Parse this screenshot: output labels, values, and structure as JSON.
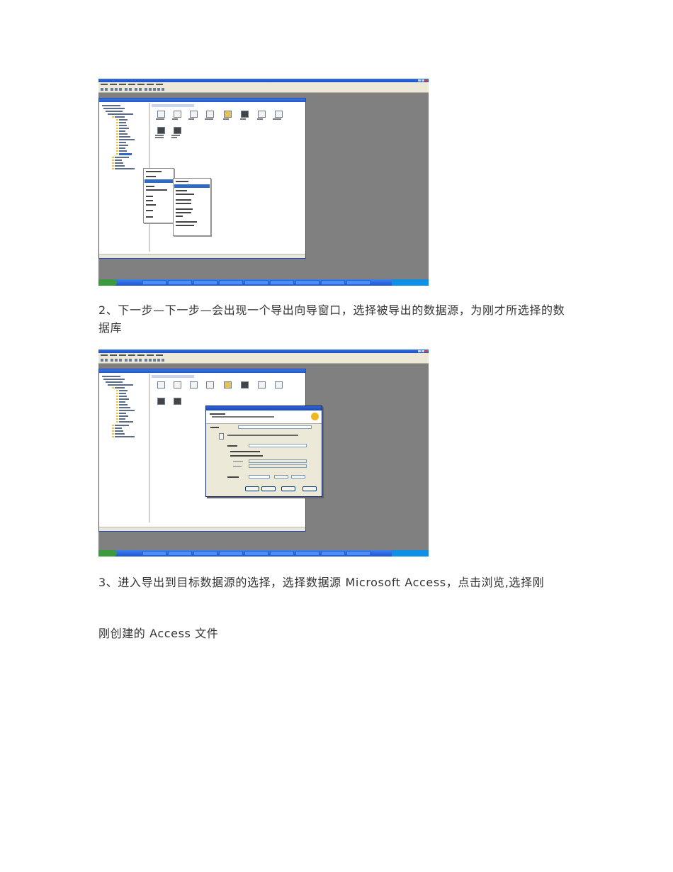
{
  "paragraphs": {
    "step2": "2、下一步—下一步—会出现一个导出向导窗口，选择被导出的数据源，为刚才所选择的数据库",
    "step3": "3、进入导出到目标数据源的选择，选择数据源 Microsoft Access，点击浏览,选择刚",
    "step3_cont": "刚创建的 Access 文件"
  },
  "screenshots": [
    {
      "description_id": "enterprise-manager-context-menu"
    },
    {
      "description_id": "export-wizard-choose-source"
    }
  ],
  "colors": {
    "xp_blue": "#2f6fe0",
    "window_gray": "#808080",
    "dialog_face": "#ece9d8",
    "highlight": "#316ac5"
  }
}
